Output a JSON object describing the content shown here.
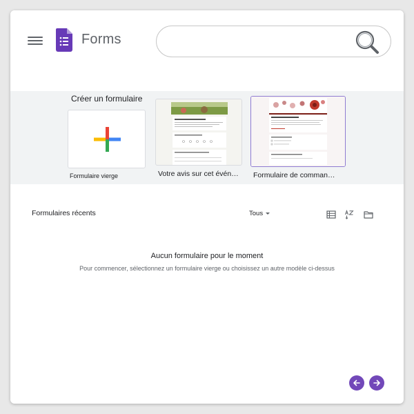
{
  "app": {
    "title": "Forms"
  },
  "search": {
    "value": "",
    "placeholder": ""
  },
  "gallery": {
    "title": "Créer un formulaire",
    "templates": [
      {
        "label": "Formulaire vierge"
      },
      {
        "label": "Votre avis sur cet évén…"
      },
      {
        "label": "Formulaire de comman…"
      }
    ]
  },
  "recent": {
    "title": "Formulaires récents",
    "owner_filter": "Tous",
    "empty_title": "Aucun formulaire pour le moment",
    "empty_subtitle": "Pour commencer, sélectionnez un formulaire vierge ou choisissez un autre modèle ci-dessus"
  },
  "colors": {
    "forms_purple": "#673ab7",
    "nav_purple": "#7248b9",
    "google_blue": "#4285f4",
    "google_red": "#ea4335",
    "google_yellow": "#fbbc04",
    "google_green": "#34a853"
  },
  "icons": {
    "menu": "hamburger-menu-icon",
    "logo": "google-forms-logo",
    "search": "magnifier-search-icon",
    "plus": "four-color-plus-icon",
    "list_view": "list-view-icon",
    "sort": "sort-az-icon",
    "folder": "folder-icon",
    "prev": "arrow-left-icon",
    "next": "arrow-right-icon"
  }
}
